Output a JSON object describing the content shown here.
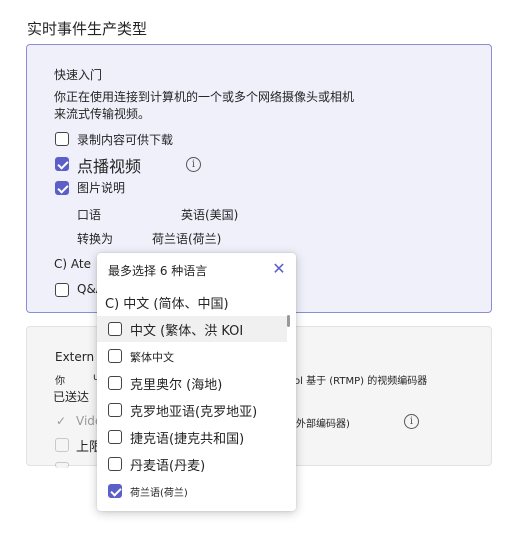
{
  "section_title": "实时事件生产类型",
  "quick": {
    "title": "快速入门",
    "desc_line1": "你正在使用连接到计算机的一个或多个网络摄像头或相机",
    "desc_line2": "来流式传输视频。",
    "record_label": "录制内容可供下载",
    "vod_label": "点播视频",
    "captions_label": "图片说明",
    "spoken_label": "口语",
    "spoken_value": "英语(美国)",
    "translate_label": "转换为",
    "translate_value": "荷兰语(荷兰)",
    "ate_label": "C) Ate",
    "qa_label": "Q&A"
  },
  "extern": {
    "title": "Extern",
    "line1_left": "你",
    "line1_mid": "u",
    "line1_right": "ol 基于 (RTMP) 的视频编码器",
    "line2": "已送达",
    "video_label": "Vide",
    "video_right": "外部编码器)",
    "upper_label": "上限"
  },
  "popup": {
    "title": "最多选择 6 种语言",
    "close_icon": "×",
    "first_line": "C) 中文 (简体、中国)",
    "items": [
      {
        "label": "中文 (繁体、洪 KOI",
        "checked": false
      },
      {
        "label": "繁体中文",
        "checked": false
      },
      {
        "label": "克里奥尔 (海地)",
        "checked": false
      },
      {
        "label": "克罗地亚语(克罗地亚)",
        "checked": false
      },
      {
        "label": "捷克语(捷克共和国)",
        "checked": false
      },
      {
        "label": "丹麦语(丹麦)",
        "checked": false
      },
      {
        "label": "荷兰语(荷兰)",
        "checked": true
      }
    ]
  },
  "colors": {
    "accent": "#5b5fc7",
    "card_border": "#8a8fd1",
    "card_bg": "#f0f0fb"
  }
}
